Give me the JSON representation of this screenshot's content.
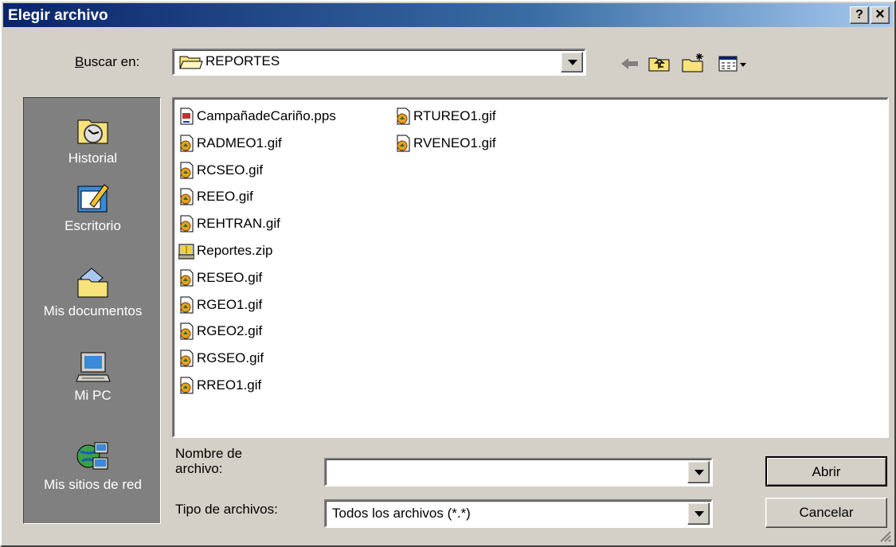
{
  "window": {
    "title": "Elegir archivo",
    "help_btn": "?",
    "close_btn": "×"
  },
  "lookin": {
    "label": "Buscar en:",
    "value": "REPORTES"
  },
  "places": [
    {
      "label": "Historial",
      "icon": "history-icon"
    },
    {
      "label": "Escritorio",
      "icon": "desktop-icon"
    },
    {
      "label": "Mis documentos",
      "icon": "my-documents-icon"
    },
    {
      "label": "Mi PC",
      "icon": "my-computer-icon"
    },
    {
      "label": "Mis sitios de red",
      "icon": "network-places-icon"
    }
  ],
  "files": [
    {
      "name": "CampañadeCariño.pps",
      "type": "pps"
    },
    {
      "name": "RADMEO1.gif",
      "type": "gif"
    },
    {
      "name": "RCSEO.gif",
      "type": "gif"
    },
    {
      "name": "REEO.gif",
      "type": "gif"
    },
    {
      "name": "REHTRAN.gif",
      "type": "gif"
    },
    {
      "name": "Reportes.zip",
      "type": "zip"
    },
    {
      "name": "RESEO.gif",
      "type": "gif"
    },
    {
      "name": "RGEO1.gif",
      "type": "gif"
    },
    {
      "name": "RGEO2.gif",
      "type": "gif"
    },
    {
      "name": "RGSEO.gif",
      "type": "gif"
    },
    {
      "name": "RREO1.gif",
      "type": "gif"
    },
    {
      "name": "RTUREO1.gif",
      "type": "gif"
    },
    {
      "name": "RVENEO1.gif",
      "type": "gif"
    }
  ],
  "filename": {
    "label_line1": "Nombre de",
    "label_line2": "archivo:",
    "value": ""
  },
  "filetype": {
    "label": "Tipo de archivos:",
    "value": "Todos los archivos (*.*)"
  },
  "buttons": {
    "open": "Abrir",
    "cancel": "Cancelar"
  },
  "colors": {
    "title_start": "#0a246a",
    "title_end": "#a6caf0",
    "places_bg": "#808080",
    "face": "#d4d0c8"
  }
}
